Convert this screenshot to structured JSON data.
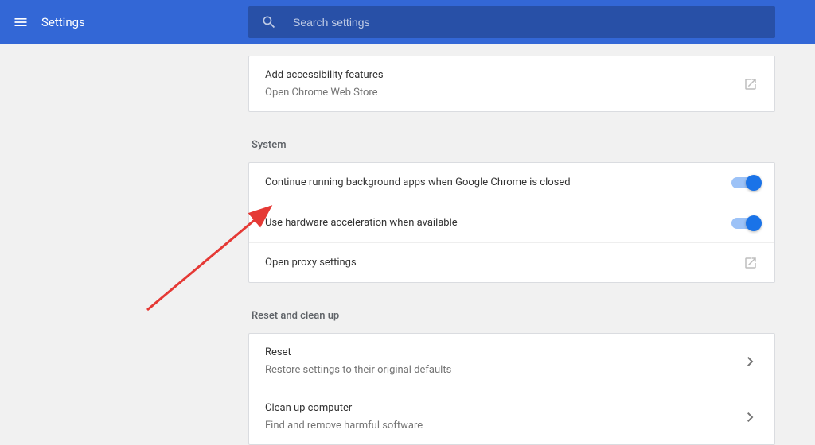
{
  "header": {
    "title": "Settings",
    "search_placeholder": "Search settings"
  },
  "accessibility": {
    "title": "Add accessibility features",
    "subtitle": "Open Chrome Web Store"
  },
  "system": {
    "header": "System",
    "background_apps": "Continue running background apps when Google Chrome is closed",
    "hw_accel": "Use hardware acceleration when available",
    "proxy": "Open proxy settings"
  },
  "reset": {
    "header": "Reset and clean up",
    "reset_title": "Reset",
    "reset_subtitle": "Restore settings to their original defaults",
    "cleanup_title": "Clean up computer",
    "cleanup_subtitle": "Find and remove harmful software"
  }
}
